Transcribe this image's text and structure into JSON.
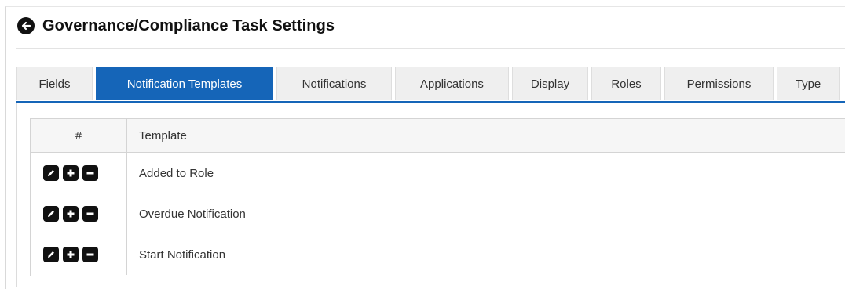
{
  "header": {
    "title": "Governance/Compliance Task Settings"
  },
  "tabs": [
    {
      "label": "Fields",
      "active": false
    },
    {
      "label": "Notification Templates",
      "active": true
    },
    {
      "label": "Notifications",
      "active": false
    },
    {
      "label": "Applications",
      "active": false
    },
    {
      "label": "Display",
      "active": false
    },
    {
      "label": "Roles",
      "active": false
    },
    {
      "label": "Permissions",
      "active": false
    },
    {
      "label": "Type",
      "active": false
    }
  ],
  "table": {
    "columns": [
      "#",
      "Template"
    ],
    "rows": [
      {
        "template": "Added to Role",
        "actions": [
          "edit-icon",
          "add-icon",
          "remove-icon"
        ]
      },
      {
        "template": "Overdue Notification",
        "actions": [
          "edit-icon",
          "add-icon",
          "remove-icon"
        ]
      },
      {
        "template": "Start Notification",
        "actions": [
          "edit-icon",
          "add-icon",
          "remove-icon"
        ]
      }
    ]
  },
  "colors": {
    "accent": "#1565b8",
    "tab_bg": "#efefef",
    "icon": "#111111"
  }
}
